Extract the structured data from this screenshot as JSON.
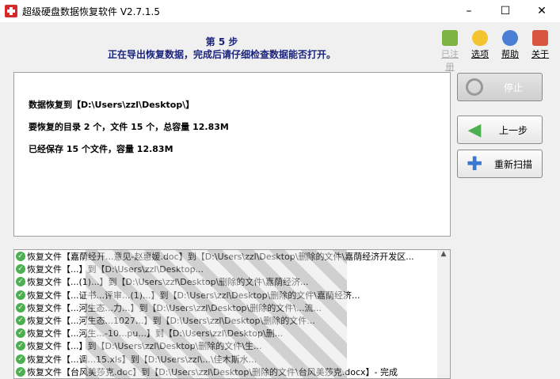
{
  "window": {
    "title": "超级硬盘数据恢复软件 V2.7.1.5",
    "minimize": "–",
    "maximize": "☐",
    "close": "✕"
  },
  "header": {
    "step": "第 5 步",
    "subtitle": "正在导出恢复数据，完成后请仔细检查数据能否打开。"
  },
  "toplinks": [
    {
      "label": "已注册",
      "icon": "cart-check-icon"
    },
    {
      "label": "选项",
      "icon": "gear-icon"
    },
    {
      "label": "帮助",
      "icon": "help-icon"
    },
    {
      "label": "关于",
      "icon": "home-icon"
    }
  ],
  "status": {
    "line1": "数据恢复到【D:\\Users\\zzl\\Desktop\\】",
    "line2": "要恢复的目录 2 个，文件 15 个，总容量 12.83M",
    "line3": "已经保存 15 个文件，容量 12.83M"
  },
  "buttons": {
    "stop": "停止",
    "back": "上一步",
    "rescan": "重新扫描"
  },
  "log": [
    "恢复文件【嘉荫经开...意见-赵惠媛.doc】到【D:\\Users\\zzl\\Desktop\\删除的文件\\嘉荫经济开发区...",
    "恢复文件【...】到【D:\\Users\\zzl\\Desktop...",
    "恢复文件【...(1)...】到【D:\\Users\\zzl\\Desktop\\删除的文件\\嘉荫经济...",
    "恢复文件【...证书...评审...(1)...】到【D:\\Users\\zzl\\Desktop\\删除的文件\\嘉荫经济...",
    "恢复文件【...河生态...力...】到【D:\\Users\\zzl\\Desktop\\删除的文件\\...流...",
    "恢复文件【...河生态...1027...】到【D:\\Users\\zzl\\Desktop\\删除的文件...",
    "恢复文件【...河生...-10...pu...】到【D:\\Users\\zzl\\Desktop\\删...",
    "恢复文件【...】到【D:\\Users\\zzl\\Desktop\\删除的文件\\生...",
    "恢复文件【...调...15.xls】到【D:\\Users\\zzl\\...\\佳木斯水...",
    "恢复文件【台风美莎克.doc】到【D:\\Users\\zzl\\Desktop\\删除的文件\\台风美莎克.docx】- 完成"
  ]
}
